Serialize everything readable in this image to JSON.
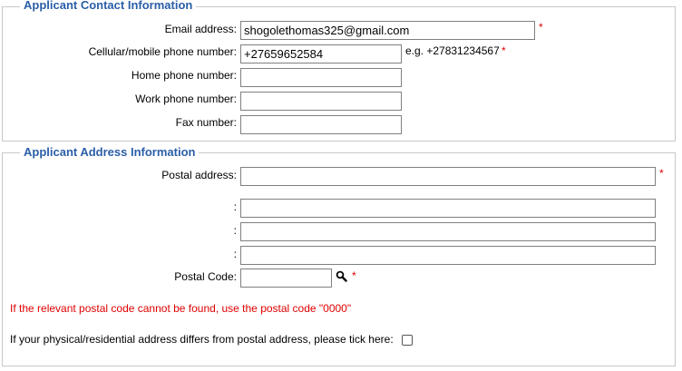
{
  "contact": {
    "legend": "Applicant Contact Information",
    "email_label": "Email address:",
    "email_value": "shogolethomas325@gmail.com",
    "cell_label": "Cellular/mobile phone number:",
    "cell_value": "+27659652584",
    "cell_hint": "e.g. +27831234567",
    "home_label": "Home phone number:",
    "home_value": "",
    "work_label": "Work phone number:",
    "work_value": "",
    "fax_label": "Fax number:",
    "fax_value": "",
    "required_mark": "*"
  },
  "address": {
    "legend": "Applicant Address Information",
    "postal_label": "Postal address:",
    "postal_line1": "",
    "continuation_label": ":",
    "postal_line2": "",
    "postal_line3": "",
    "postal_line4": "",
    "postal_code_label": "Postal Code:",
    "postal_code_value": "",
    "search_icon": "magnifier-icon",
    "postal_code_warning": "If the relevant postal code cannot be found, use the postal code \"0000\"",
    "physical_differs_label": "If your physical/residential address differs from postal address, please tick here:",
    "physical_differs_checked": false
  },
  "colors": {
    "legend": "#2a5ea8",
    "required": "#e00000",
    "warning": "#e00000"
  }
}
